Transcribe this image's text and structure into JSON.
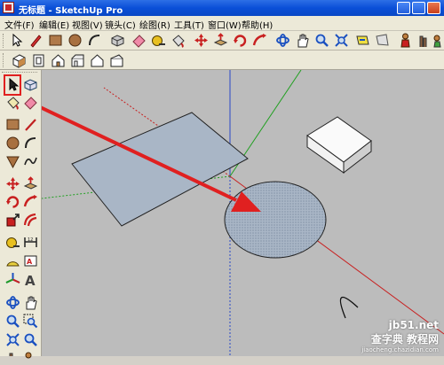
{
  "window": {
    "title": "无标题 - SketchUp Pro"
  },
  "menu": [
    "文件(F)",
    "编辑(E)",
    "视图(V)",
    "镜头(C)",
    "绘图(R)",
    "工具(T)",
    "窗口(W)",
    "帮助(H)"
  ],
  "toolbar_primary": [
    "select-icon",
    "pencil-icon",
    "rectangle-icon",
    "circle-icon",
    "arc-icon",
    "eraser-icon",
    "tape-measure-icon",
    "paint-bucket-icon",
    "eraser-icon",
    "push-pull-icon",
    "rotate-icon",
    "follow-me-icon",
    "orbit-icon",
    "pan-icon",
    "zoom-icon",
    "zoom-extents-icon",
    "previous-view-icon",
    "next-view-icon",
    "position-camera-icon",
    "walk-icon",
    "look-around-icon"
  ],
  "toolbar_views": [
    "iso-view-icon",
    "top-view-icon",
    "front-view-icon",
    "right-view-icon",
    "back-view-icon",
    "left-view-icon"
  ],
  "sidebar_tools": [
    "select-icon",
    "make-component-icon",
    "paint-bucket-icon",
    "eraser-icon",
    "rectangle-icon",
    "line-icon",
    "circle-icon",
    "arc-icon",
    "polygon-icon",
    "freehand-icon",
    "move-icon",
    "push-pull-icon",
    "rotate-icon",
    "follow-me-icon",
    "scale-icon",
    "offset-icon",
    "tape-measure-icon",
    "dimension-icon",
    "protractor-icon",
    "text-icon",
    "axes-icon",
    "3d-text-icon",
    "orbit-icon",
    "pan-icon",
    "zoom-icon",
    "zoom-window-icon",
    "zoom-extents-icon",
    "previous-icon",
    "walk-icon",
    "look-around-icon"
  ],
  "watermark": {
    "site": "jb51.net",
    "brand": "查字典 教程网",
    "url": "jiaocheng.chazidian.com"
  },
  "colors": {
    "title_bar": "#0a4fd8",
    "canvas": "#bcbcbc",
    "shape_fill": "#a9b6c6",
    "arrow": "#e02020"
  }
}
